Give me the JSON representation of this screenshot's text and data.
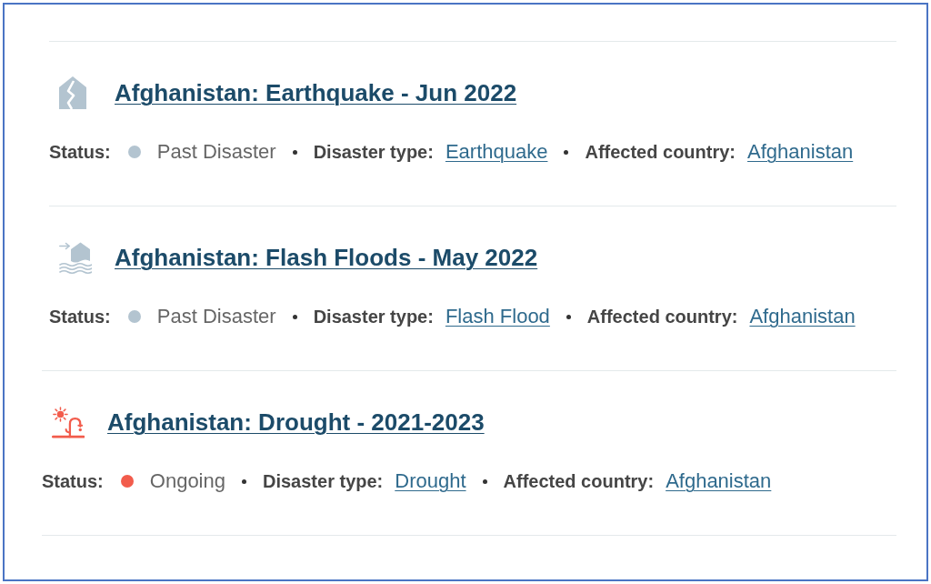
{
  "disasters": [
    {
      "kind": "earthquake",
      "title": "Afghanistan: Earthquake - Jun 2022",
      "status": {
        "label": "Status:",
        "value": "Past Disaster",
        "color": "#b3c4d0"
      },
      "disaster_type": {
        "label": "Disaster type:",
        "value": "Earthquake"
      },
      "affected_country": {
        "label": "Affected country:",
        "value": "Afghanistan"
      }
    },
    {
      "kind": "flash_flood",
      "title": "Afghanistan: Flash Floods - May 2022",
      "status": {
        "label": "Status:",
        "value": "Past Disaster",
        "color": "#b3c4d0"
      },
      "disaster_type": {
        "label": "Disaster type:",
        "value": "Flash Flood"
      },
      "affected_country": {
        "label": "Affected country:",
        "value": "Afghanistan"
      }
    },
    {
      "kind": "drought",
      "title": "Afghanistan: Drought - 2021-2023",
      "status": {
        "label": "Status:",
        "value": "Ongoing",
        "color": "#f25c4c"
      },
      "disaster_type": {
        "label": "Disaster type:",
        "value": "Drought"
      },
      "affected_country": {
        "label": "Affected country:",
        "value": "Afghanistan"
      }
    }
  ]
}
